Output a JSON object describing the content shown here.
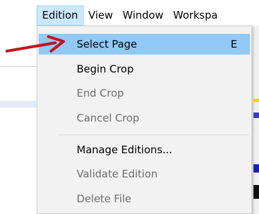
{
  "menubar": {
    "items": [
      {
        "label": "Edition"
      },
      {
        "label": "View"
      },
      {
        "label": "Window"
      },
      {
        "label": "Workspa"
      }
    ]
  },
  "dropdown": {
    "items": [
      {
        "label": "Select Page",
        "shortcut": "E",
        "enabled": true,
        "highlighted": true
      },
      {
        "label": "Begin Crop",
        "shortcut": "",
        "enabled": true
      },
      {
        "label": "End Crop",
        "shortcut": "",
        "enabled": false
      },
      {
        "label": "Cancel Crop",
        "shortcut": "",
        "enabled": false
      },
      {
        "label": "Manage Editions...",
        "shortcut": "",
        "enabled": true
      },
      {
        "label": "Validate Edition",
        "shortcut": "",
        "enabled": false
      },
      {
        "label": "Delete File",
        "shortcut": "",
        "enabled": false
      }
    ]
  },
  "annotation": {
    "arrow_color": "#c0141b",
    "highlight_color": "#91c9f7",
    "menu_open_color": "#cce8ff"
  }
}
